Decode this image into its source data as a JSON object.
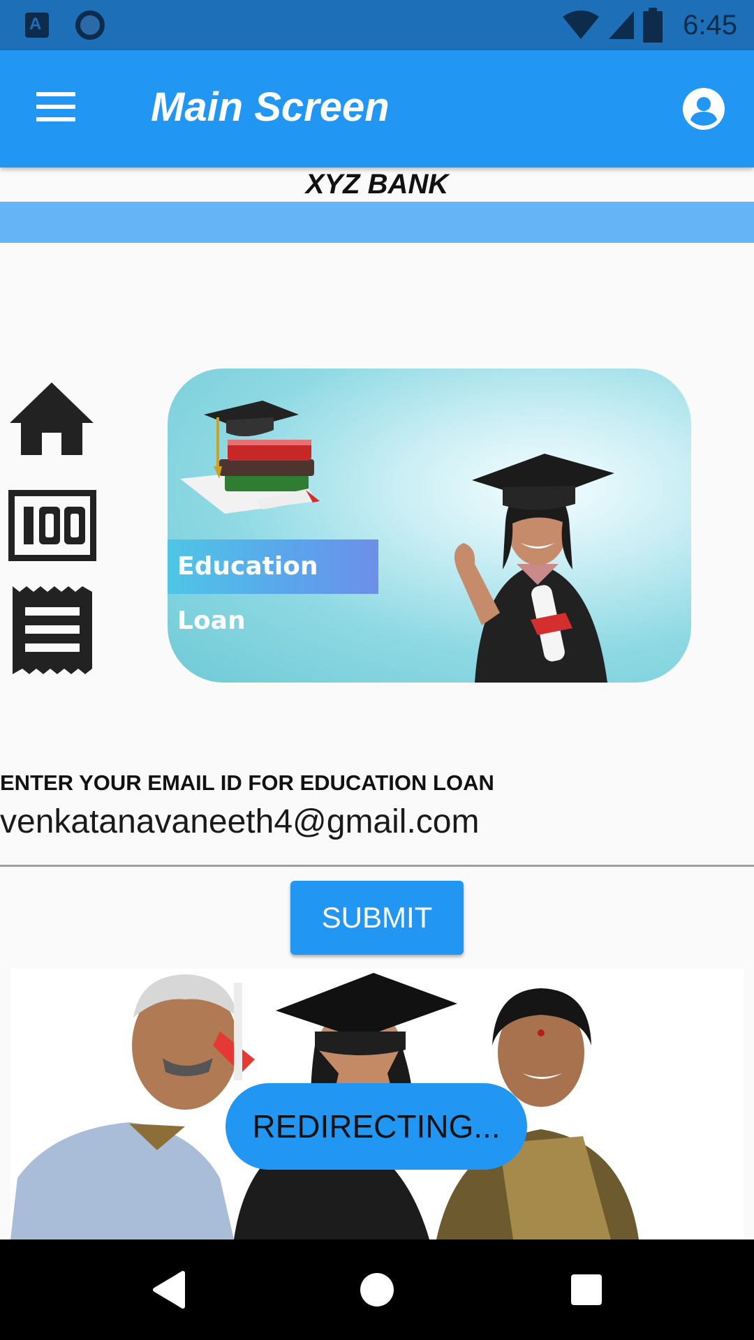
{
  "status_bar": {
    "time": "6:45",
    "icons": [
      "a-keyboard-icon",
      "circle-app-icon",
      "wifi-icon",
      "signal-icon",
      "battery-icon"
    ]
  },
  "app_bar": {
    "title": "Main Screen",
    "menu_icon": "hamburger-menu-icon",
    "account_icon": "account-circle-icon",
    "color": "#2196f3"
  },
  "bank": {
    "name": "XYZ BANK",
    "band_color": "#64b5f6"
  },
  "side_icons": [
    "home-icon",
    "hundred-icon",
    "receipt-icon"
  ],
  "banner": {
    "label": "Education Loan"
  },
  "email_form": {
    "label": "ENTER YOUR EMAIL ID FOR EDUCATION LOAN",
    "value": "venkatanavaneeth4@gmail.com",
    "submit_label": "SUBMIT"
  },
  "toast": {
    "message": "REDIRECTING..."
  },
  "nav_bar": {
    "buttons": [
      "back-icon",
      "home-circle-icon",
      "recents-icon"
    ]
  }
}
